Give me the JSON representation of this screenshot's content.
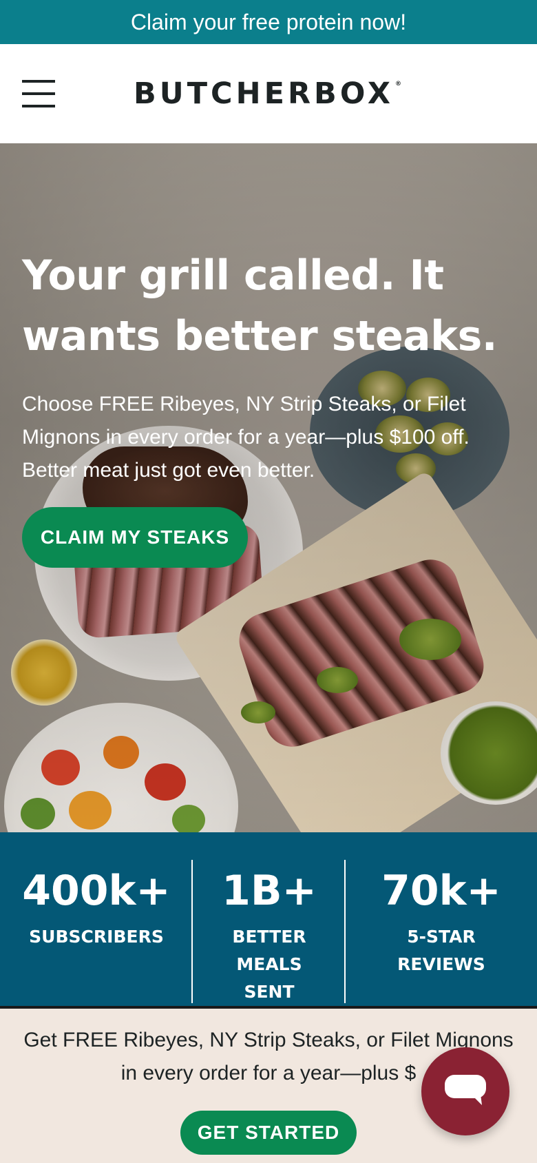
{
  "promo_bar": {
    "text": "Claim your free protein now!"
  },
  "header": {
    "logo": "BUTCHERBOX",
    "logo_mark": "®",
    "menu_icon": "hamburger-menu-icon"
  },
  "hero": {
    "title": "Your grill called. It wants better steaks.",
    "subtitle": "Choose FREE Ribeyes, NY Strip Steaks, or Filet Mignons in every order for a year—plus $100 off. Better meat just got even better.",
    "cta_label": "CLAIM MY STEAKS"
  },
  "stats": [
    {
      "value": "400k+",
      "label": "SUBSCRIBERS"
    },
    {
      "value": "1B+",
      "label": "BETTER MEALS SENT"
    },
    {
      "value": "70k+",
      "label": "5-STAR REVIEWS"
    }
  ],
  "sticky_footer": {
    "text": "Get FREE Ribeyes, NY Strip Steaks, or Filet Mignons in every order for a year—plus $",
    "cta_label": "GET STARTED"
  },
  "chat": {
    "icon": "chat-bubble-icon"
  },
  "colors": {
    "promo": "#0b7f8c",
    "cta_green": "#0a8a52",
    "stats_bg": "#045876",
    "footer_bg": "#f1e7df",
    "chat_red": "#8a2233"
  }
}
